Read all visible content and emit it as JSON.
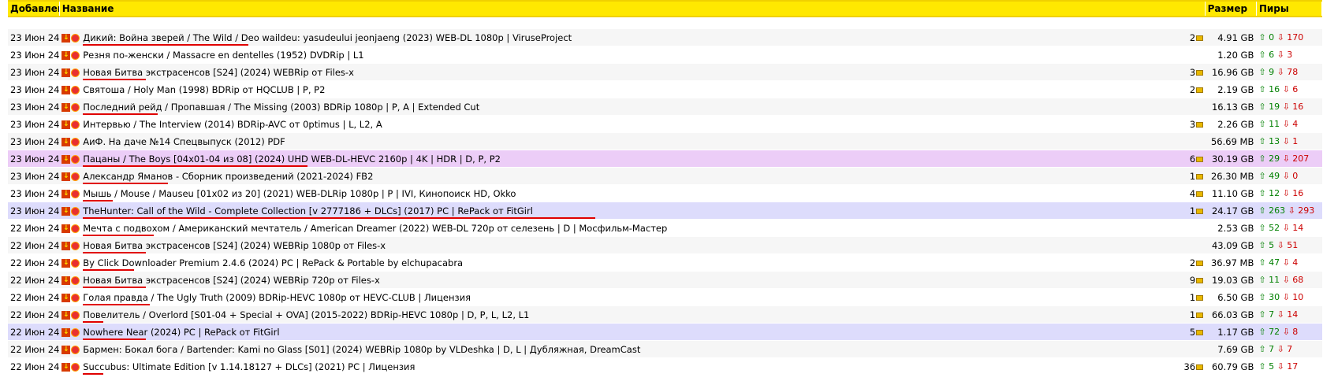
{
  "columns": {
    "added": "Добавлен",
    "name": "Название",
    "size": "Размер",
    "peers": "Пиры"
  },
  "rows": [
    {
      "date": "23 Июн 24",
      "title": "Дикий: Война зверей / The Wild / Deo waildeu: yasudeului jeonjaeng (2023) WEB-DL 1080p | ViruseProject",
      "comments": "2",
      "size": "4.91 GB",
      "seeds": "0",
      "leechers": "170",
      "style": "",
      "ul": [
        0,
        210
      ]
    },
    {
      "date": "23 Июн 24",
      "title": "Резня по-женски / Massacre en dentelles (1952) DVDRip | L1",
      "comments": "",
      "size": "1.20 GB",
      "seeds": "6",
      "leechers": "3",
      "style": "alt",
      "ul": null
    },
    {
      "date": "23 Июн 24",
      "title": "Новая Битва экстрасенсов [S24] (2024) WEBRip от Files-x",
      "comments": "3",
      "size": "16.96 GB",
      "seeds": "9",
      "leechers": "78",
      "style": "",
      "ul": [
        0,
        80
      ]
    },
    {
      "date": "23 Июн 24",
      "title": "Святоша / Holy Man (1998) BDRip от HQCLUB | P, P2",
      "comments": "2",
      "size": "2.19 GB",
      "seeds": "16",
      "leechers": "6",
      "style": "alt",
      "ul": null
    },
    {
      "date": "23 Июн 24",
      "title": "Последний рейд / Пропавшая / The Missing (2003) BDRip 1080p | P, A | Extended Cut",
      "comments": "",
      "size": "16.13 GB",
      "seeds": "19",
      "leechers": "16",
      "style": "",
      "ul": [
        0,
        95
      ]
    },
    {
      "date": "23 Июн 24",
      "title": "Интервью / The Interview (2014) BDRip-AVC от 0ptimus | L, L2, A",
      "comments": "3",
      "size": "2.26 GB",
      "seeds": "11",
      "leechers": "4",
      "style": "alt",
      "ul": null
    },
    {
      "date": "23 Июн 24",
      "title": "АиФ. На даче №14 Спецвыпуск (2012) PDF",
      "comments": "",
      "size": "56.69 MB",
      "seeds": "13",
      "leechers": "1",
      "style": "",
      "ul": null
    },
    {
      "date": "23 Июн 24",
      "title": "Пацаны / The Boys [04x01-04 из 08] (2024) UHD WEB-DL-HEVC 2160p | 4K | HDR | D, P, P2",
      "comments": "6",
      "size": "30.19 GB",
      "seeds": "29",
      "leechers": "207",
      "style": "pink",
      "ul": [
        0,
        285
      ]
    },
    {
      "date": "23 Июн 24",
      "title": "Александр Яманов - Сборник произведений (2021-2024) FB2",
      "comments": "1",
      "size": "26.30 MB",
      "seeds": "49",
      "leechers": "0",
      "style": "",
      "ul": [
        0,
        108
      ]
    },
    {
      "date": "23 Июн 24",
      "title": "Мышь / Mouse / Mauseu [01x02 из 20] (2021) WEB-DLRip 1080p | P | IVI, Кинопоиск HD, Okko",
      "comments": "4",
      "size": "11.10 GB",
      "seeds": "12",
      "leechers": "16",
      "style": "alt",
      "ul": [
        0,
        38
      ]
    },
    {
      "date": "23 Июн 24",
      "title": "TheHunter: Call of the Wild - Complete Collection [v 2777186 + DLCs] (2017) PC | RePack от FitGirl",
      "comments": "1",
      "size": "24.17 GB",
      "seeds": "263",
      "leechers": "293",
      "style": "blue",
      "ul": [
        0,
        650
      ]
    },
    {
      "date": "22 Июн 24",
      "title": "Мечта с подвохом / Американский мечтатель / American Dreamer (2022) WEB-DL 720p от селезень | D | Мосфильм-Мастер",
      "comments": "",
      "size": "2.53 GB",
      "seeds": "52",
      "leechers": "14",
      "style": "alt",
      "ul": [
        0,
        90
      ]
    },
    {
      "date": "22 Июн 24",
      "title": "Новая Битва экстрасенсов [S24] (2024) WEBRip 1080p от Files-x",
      "comments": "",
      "size": "43.09 GB",
      "seeds": "5",
      "leechers": "51",
      "style": "",
      "ul": [
        0,
        80
      ]
    },
    {
      "date": "22 Июн 24",
      "title": "By Click Downloader Premium 2.4.6 (2024) PC | RePack & Portable by elchupacabra",
      "comments": "2",
      "size": "36.97 MB",
      "seeds": "47",
      "leechers": "4",
      "style": "alt",
      "ul": [
        0,
        65
      ]
    },
    {
      "date": "22 Июн 24",
      "title": "Новая Битва экстрасенсов [S24] (2024) WEBRip 720p от Files-x",
      "comments": "9",
      "size": "19.03 GB",
      "seeds": "11",
      "leechers": "68",
      "style": "",
      "ul": [
        0,
        80
      ]
    },
    {
      "date": "22 Июн 24",
      "title": "Голая правда / The Ugly Truth (2009) BDRip-HEVC 1080p от HEVC-CLUB | Лицензия",
      "comments": "1",
      "size": "6.50 GB",
      "seeds": "30",
      "leechers": "10",
      "style": "alt",
      "ul": [
        0,
        85
      ]
    },
    {
      "date": "22 Июн 24",
      "title": "Повелитель / Overlord [S01-04 + Special + OVA] (2015-2022) BDRip-HEVC 1080p | D, P, L, L2, L1",
      "comments": "1",
      "size": "66.03 GB",
      "seeds": "7",
      "leechers": "14",
      "style": "",
      "ul": [
        0,
        26
      ]
    },
    {
      "date": "22 Июн 24",
      "title": "Nowhere Near (2024) PC | RePack от FitGirl",
      "comments": "5",
      "size": "1.17 GB",
      "seeds": "72",
      "leechers": "8",
      "style": "blue",
      "ul": [
        0,
        80
      ]
    },
    {
      "date": "22 Июн 24",
      "title": "Бармен: Бокал бога / Bartender: Kami no Glass [S01] (2024) WEBRip 1080p by VLDeshka | D, L | Дубляжная, DreamCast",
      "comments": "",
      "size": "7.69 GB",
      "seeds": "7",
      "leechers": "7",
      "style": "",
      "ul": null
    },
    {
      "date": "22 Июн 24",
      "title": "Succubus: Ultimate Edition [v 1.14.18127 + DLCs] (2021) PC | Лицензия",
      "comments": "36",
      "size": "60.79 GB",
      "seeds": "5",
      "leechers": "17",
      "style": "alt",
      "ul": [
        0,
        26
      ]
    }
  ],
  "icons": {
    "download": "download-icon",
    "magnet": "magnet-icon",
    "comment": "comment-icon",
    "seed": "arrow-up-icon",
    "leech": "arrow-down-icon"
  },
  "colors": {
    "header": "#ffe800",
    "pink_row": "#eccdf7",
    "blue_row": "#dddcfc",
    "seed": "#008000",
    "leech": "#cc0000",
    "underline": "#e00000"
  }
}
